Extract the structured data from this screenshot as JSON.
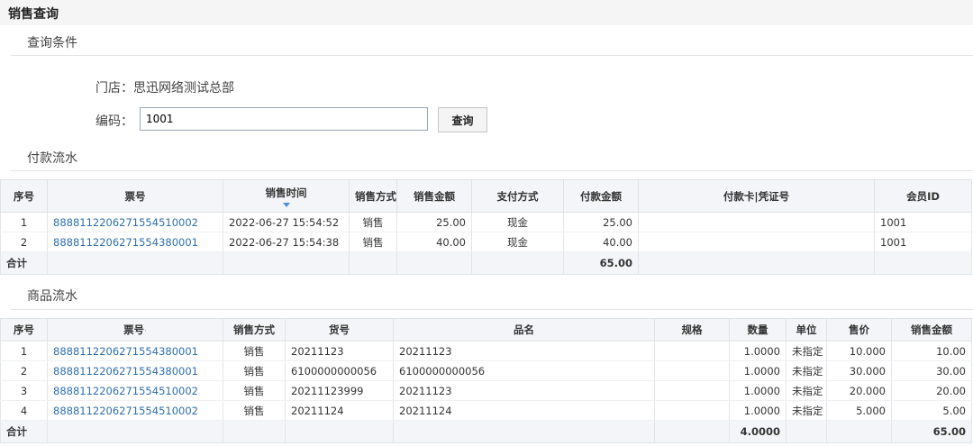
{
  "page": {
    "title": "销售查询"
  },
  "query": {
    "section_title": "查询条件",
    "store_label": "门店：",
    "store_value": "思迅网络测试总部",
    "code_label": "编码：",
    "code_value": "1001",
    "search_label": "查询"
  },
  "payment": {
    "section_title": "付款流水",
    "columns": [
      "序号",
      "票号",
      "销售时间",
      "销售方式",
      "销售金额",
      "支付方式",
      "付款金额",
      "付款卡|凭证号",
      "会员ID"
    ],
    "rows": [
      {
        "no": "1",
        "ticket": "8888112206271554510002",
        "time": "2022-06-27 15:54:52",
        "mode": "销售",
        "amount": "25.00",
        "pay": "现金",
        "paid": "25.00",
        "card": "",
        "member": "1001"
      },
      {
        "no": "2",
        "ticket": "8888112206271554380001",
        "time": "2022-06-27 15:54:38",
        "mode": "销售",
        "amount": "40.00",
        "pay": "现金",
        "paid": "40.00",
        "card": "",
        "member": "1001"
      }
    ],
    "total_label": "合计",
    "total_paid": "65.00"
  },
  "goods": {
    "section_title": "商品流水",
    "columns": [
      "序号",
      "票号",
      "销售方式",
      "货号",
      "品名",
      "规格",
      "数量",
      "单位",
      "售价",
      "销售金额"
    ],
    "rows": [
      {
        "no": "1",
        "ticket": "8888112206271554380001",
        "mode": "销售",
        "code": "20211123",
        "name": "20211123",
        "spec": "",
        "qty": "1.0000",
        "unit": "未指定",
        "price": "10.000",
        "amount": "10.00"
      },
      {
        "no": "2",
        "ticket": "8888112206271554380001",
        "mode": "销售",
        "code": "6100000000056",
        "name": "6100000000056",
        "spec": "",
        "qty": "1.0000",
        "unit": "未指定",
        "price": "30.000",
        "amount": "30.00"
      },
      {
        "no": "3",
        "ticket": "8888112206271554510002",
        "mode": "销售",
        "code": "20211123999",
        "name": "20211123",
        "spec": "",
        "qty": "1.0000",
        "unit": "未指定",
        "price": "20.000",
        "amount": "20.00"
      },
      {
        "no": "4",
        "ticket": "8888112206271554510002",
        "mode": "销售",
        "code": "20211124",
        "name": "20211124",
        "spec": "",
        "qty": "1.0000",
        "unit": "未指定",
        "price": "5.000",
        "amount": "5.00"
      }
    ],
    "total_label": "合计",
    "total_qty": "4.0000",
    "total_amount": "65.00"
  }
}
